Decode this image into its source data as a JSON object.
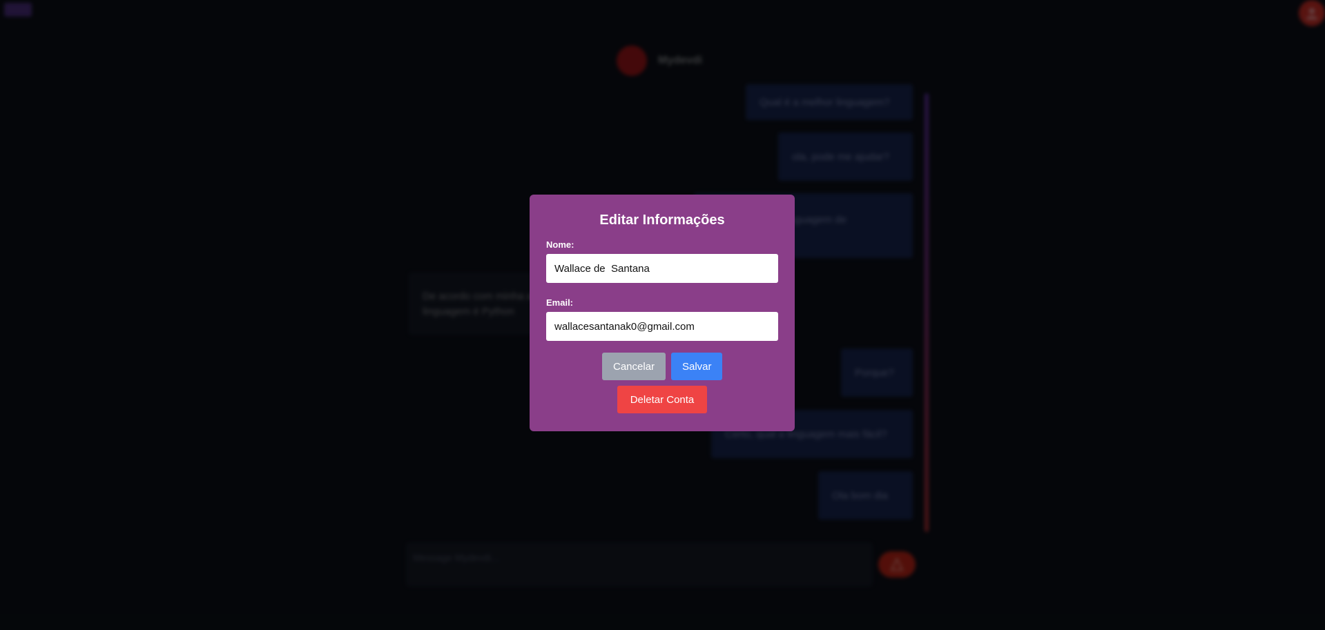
{
  "app": {
    "brand_name": "Mydevdi"
  },
  "chat": {
    "messages": [
      {
        "role": "user",
        "text": "Qual é a melhor linguagem?"
      },
      {
        "role": "user",
        "text": "ola, pode me ajudar?"
      },
      {
        "role": "user",
        "text": "Qual é a melhor linguagem de programação?"
      },
      {
        "role": "bot",
        "text": "De acordo com minha análise, a melhor linguagem é Python"
      },
      {
        "role": "user",
        "text": "Porque?"
      },
      {
        "role": "user",
        "text": "Certo, qual a linguagem mais fácil?"
      },
      {
        "role": "user",
        "text": "Ola bom dia"
      }
    ],
    "input_placeholder": "Message Mydevdi..."
  },
  "modal": {
    "title": "Editar Informações",
    "name_label": "Nome:",
    "name_value": "Wallace de  Santana",
    "email_label": "Email:",
    "email_value": "wallacesantanak0@gmail.com",
    "cancel_label": "Cancelar",
    "save_label": "Salvar",
    "delete_label": "Deletar Conta"
  },
  "colors": {
    "modal_bg": "#8a3e89",
    "save": "#3b82f6",
    "cancel": "#9ca3af",
    "delete": "#ef4444"
  }
}
